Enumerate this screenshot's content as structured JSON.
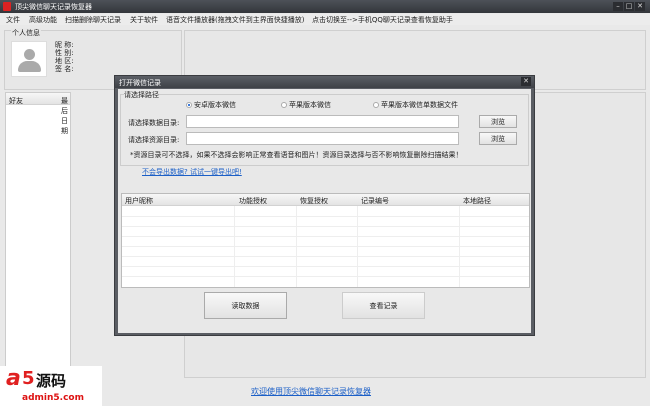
{
  "window": {
    "title": "顶尖微信聊天记录恢复器",
    "minimize": "–",
    "maximize": "□",
    "close": "✕"
  },
  "menu": [
    "文件",
    "高级功能",
    "扫描删除聊天记录",
    "关于软件",
    "语音文件播放器(拖拽文件到主界面快捷播放)",
    "点击切换至-->手机QQ聊天记录查看恢复助手"
  ],
  "profile": {
    "group": "个人信息",
    "fields": [
      "昵 称:",
      "性 别:",
      "地 区:",
      "签 名:"
    ]
  },
  "friends": {
    "columns": [
      "好友",
      "最后日期"
    ]
  },
  "footer_link": "欢迎使用顶尖微信聊天记录恢复器",
  "dialog": {
    "title": "打开微信记录",
    "close": "✕",
    "group": "请选择路径",
    "radios": [
      {
        "label": "安卓版本微信",
        "checked": true
      },
      {
        "label": "苹果版本微信",
        "checked": false
      },
      {
        "label": "苹果版本微信单数据文件",
        "checked": false
      }
    ],
    "data_dir_label": "请选择数据目录:",
    "data_dir_value": "",
    "res_dir_label": "请选择资源目录:",
    "res_dir_value": "",
    "browse": "浏览",
    "note": "*资源目录可不选择，如果不选择会影响正常查看语音和图片！资源目录选择与否不影响恢复删除扫描结果！",
    "link": "不会导出数据? 试试一键导出吧!",
    "table_columns": [
      "用户昵称",
      "功能授权",
      "恢复授权",
      "记录编号",
      "本地路径"
    ],
    "read_button": "读取数据",
    "view_button": "查看记录"
  },
  "watermark": {
    "logo": "a5源码",
    "url": "admin5.com"
  }
}
